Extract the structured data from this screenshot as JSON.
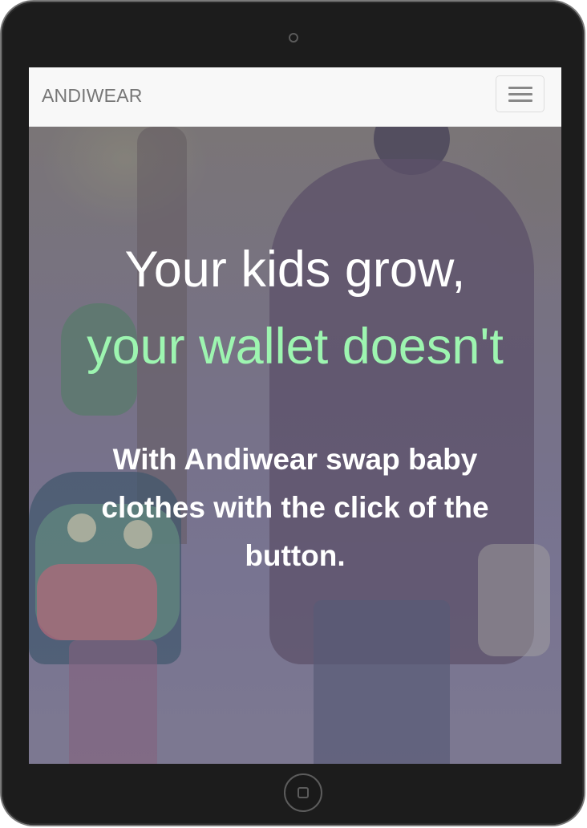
{
  "navbar": {
    "brand": "ANDIWEAR",
    "menu_icon": "hamburger-menu-icon"
  },
  "hero": {
    "headline_line1": "Your kids grow,",
    "headline_line2": "your wallet doesn't",
    "subtext": "With Andiwear swap baby clothes with the click of the button."
  },
  "colors": {
    "accent_green": "#9df5b0",
    "navbar_bg": "#f8f8f8",
    "brand_text": "#777777",
    "device_frame": "#1c1c1c"
  }
}
